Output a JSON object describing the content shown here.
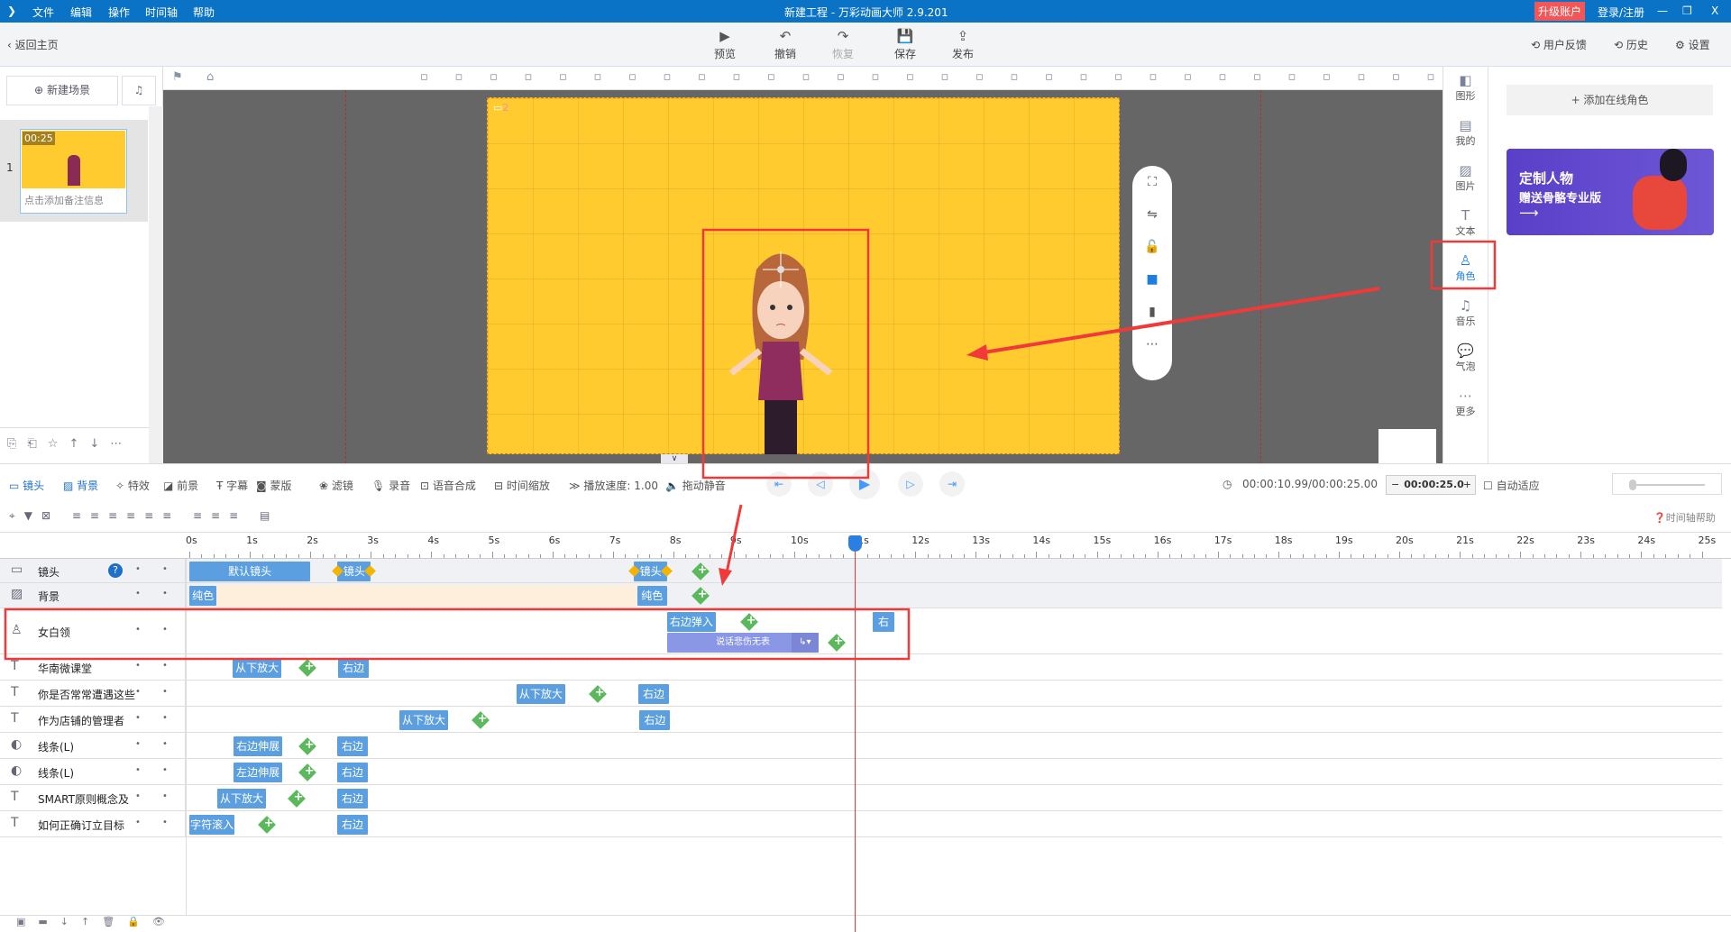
{
  "titlebar": {
    "menus": [
      "文件",
      "编辑",
      "操作",
      "时间轴",
      "帮助"
    ],
    "title": "新建工程 - 万彩动画大师 2.9.201",
    "upgrade": "升级账户",
    "login": "登录/注册",
    "min": "—",
    "restore": "❐",
    "close": "X"
  },
  "toolbar": {
    "back": "返回主页",
    "buttons": [
      {
        "label": "预览",
        "icon": "▶"
      },
      {
        "label": "撤销",
        "icon": "↶"
      },
      {
        "label": "恢复",
        "icon": "↷"
      },
      {
        "label": "保存",
        "icon": "💾"
      },
      {
        "label": "发布",
        "icon": "⇪"
      }
    ],
    "feedback": "用户反馈",
    "history": "历史",
    "settings": "设置"
  },
  "left": {
    "new_scene": "新建场景",
    "scene_index": "1",
    "scene_time": "00:25",
    "scene_note": "点击添加备注信息"
  },
  "canvas": {
    "scene_badge": "2"
  },
  "iconcol": [
    {
      "label": "图形",
      "icon": "◧"
    },
    {
      "label": "我的",
      "icon": "▤"
    },
    {
      "label": "图片",
      "icon": "▨"
    },
    {
      "label": "文本",
      "icon": "T"
    },
    {
      "label": "角色",
      "icon": "♙"
    },
    {
      "label": "音乐",
      "icon": "♫"
    },
    {
      "label": "气泡",
      "icon": "💬"
    },
    {
      "label": "更多",
      "icon": "⋯"
    }
  ],
  "right": {
    "add_role": "+ 添加在线角色",
    "banner_title": "定制人物",
    "banner_sub": "赠送骨骼专业版",
    "banner_arrow": "⟶"
  },
  "tltool": {
    "items": [
      "镜头",
      "背景",
      "特效",
      "前景",
      "字幕",
      "蒙版",
      "滤镜",
      "录音",
      "语音合成",
      "时间缩放",
      "播放速度: 1.00",
      "拖动静音"
    ],
    "time": "00:00:10.99/00:00:25.00",
    "duration": "00:00:25.0",
    "auto_fit": "自动适应",
    "help": "时间轴帮助"
  },
  "ruler": {
    "max": 25,
    "origin": 210
  },
  "playhead_s": 11,
  "rows": [
    {
      "name": "镜头",
      "icon": "▭",
      "h": 27,
      "blocks": [
        {
          "t": "默认镜头",
          "s": 0,
          "e": 2.0
        },
        {
          "t": "镜头",
          "s": 2.45,
          "e": 3.0,
          "kf": true
        },
        {
          "t": "镜头",
          "s": 7.35,
          "e": 7.9,
          "kf": true
        }
      ],
      "plus": [
        8.45
      ]
    },
    {
      "name": "背景",
      "icon": "▨",
      "h": 28,
      "band": [
        0.45,
        7.4
      ],
      "blocks": [
        {
          "t": "纯色",
          "s": 0,
          "e": 0.45
        },
        {
          "t": "纯色",
          "s": 7.4,
          "e": 7.9
        }
      ],
      "plus": [
        8.45
      ]
    },
    {
      "name": "女白领",
      "icon": "♙",
      "h": 51,
      "blocks": [
        {
          "t": "右边弹入",
          "s": 7.9,
          "e": 8.7
        },
        {
          "t": "右",
          "s": 11.3,
          "e": 11.65
        }
      ],
      "plus": [
        9.25
      ],
      "sub": {
        "t": "说话悲伤无表",
        "s": 7.9,
        "e": 10.4,
        "plus": 10.7
      }
    },
    {
      "name": "华南微课堂",
      "icon": "T",
      "h": 29,
      "blocks": [
        {
          "t": "从下放大",
          "s": 0.72,
          "e": 1.52
        },
        {
          "t": "右边",
          "s": 2.46,
          "e": 2.97
        }
      ],
      "plus": [
        1.95
      ]
    },
    {
      "name": "你是否常常遭遇这些",
      "icon": "T",
      "h": 29,
      "blocks": [
        {
          "t": "从下放大",
          "s": 5.41,
          "e": 6.21
        },
        {
          "t": "右边",
          "s": 7.42,
          "e": 7.93
        }
      ],
      "plus": [
        6.75
      ]
    },
    {
      "name": "作为店铺的管理者",
      "icon": "T",
      "h": 29,
      "blocks": [
        {
          "t": "从下放大",
          "s": 3.47,
          "e": 4.28
        },
        {
          "t": "右边",
          "s": 7.44,
          "e": 7.95
        }
      ],
      "plus": [
        4.82
      ]
    },
    {
      "name": "线条(L)",
      "icon": "◐",
      "h": 29,
      "blocks": [
        {
          "t": "右边伸展",
          "s": 0.73,
          "e": 1.54
        },
        {
          "t": "右边",
          "s": 2.44,
          "e": 2.95
        }
      ],
      "plus": [
        1.95
      ]
    },
    {
      "name": "线条(L)",
      "icon": "◐",
      "h": 29,
      "blocks": [
        {
          "t": "左边伸展",
          "s": 0.73,
          "e": 1.54
        },
        {
          "t": "右边",
          "s": 2.44,
          "e": 2.95
        }
      ],
      "plus": [
        1.95
      ]
    },
    {
      "name": "SMART原则概念及",
      "icon": "T",
      "h": 29,
      "blocks": [
        {
          "t": "从下放大",
          "s": 0.46,
          "e": 1.27
        },
        {
          "t": "右边",
          "s": 2.44,
          "e": 2.95
        }
      ],
      "plus": [
        1.78
      ]
    },
    {
      "name": "如何正确订立目标",
      "icon": "T",
      "h": 29,
      "blocks": [
        {
          "t": "字符滚入",
          "s": 0,
          "e": 0.75
        },
        {
          "t": "右边",
          "s": 2.44,
          "e": 2.95
        }
      ],
      "plus": [
        1.28
      ]
    }
  ],
  "colors": {
    "accent": "#0a73c6",
    "block": "#5b9fe0",
    "stage": "#ffcb2f",
    "annot": "#f03a3a"
  }
}
